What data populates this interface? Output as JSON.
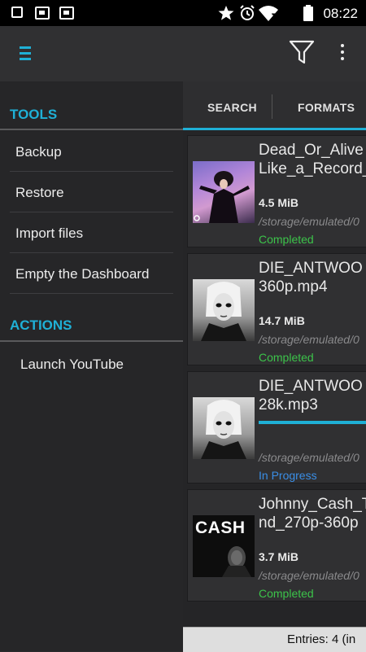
{
  "status_bar": {
    "time": "08:22",
    "icons": [
      "stop-icon",
      "image-icon",
      "image-icon",
      "star-icon",
      "alarm-icon",
      "wifi-icon",
      "battery-icon"
    ]
  },
  "app_bar": {
    "menu_icon": "hamburger-icon",
    "filter_icon": "filter-icon",
    "more_icon": "more-vert-icon"
  },
  "drawer": {
    "tools_header": "TOOLS",
    "tools": [
      "Backup",
      "Restore",
      "Import files",
      "Empty the Dashboard"
    ],
    "actions_header": "ACTIONS",
    "actions": [
      "Launch YouTube"
    ]
  },
  "tabs": [
    "SEARCH",
    "FORMATS"
  ],
  "downloads": [
    {
      "title_line1": "Dead_Or_Alive",
      "title_line2": "Like_a_Record_",
      "size": "4.5 MiB",
      "path": "/storage/emulated/0",
      "status": "Completed"
    },
    {
      "title_line1": "DIE_ANTWOO",
      "title_line2": "360p.mp4",
      "size": "14.7 MiB",
      "path": "/storage/emulated/0",
      "status": "Completed"
    },
    {
      "title_line1": "DIE_ANTWOO",
      "title_line2": "28k.mp3",
      "size": "",
      "path": "/storage/emulated/0",
      "status": "In Progress",
      "progress": 1.0
    },
    {
      "title_line1": "Johnny_Cash_T",
      "title_line2": "nd_270p-360p",
      "size": "3.7 MiB",
      "path": "/storage/emulated/0",
      "status": "Completed",
      "thumb_text": "CASH"
    }
  ],
  "footer": {
    "entries": "Entries: 4 (in"
  },
  "colors": {
    "accent": "#1fb0d6",
    "completed": "#3cc34a",
    "in_progress": "#3a8ee6"
  }
}
